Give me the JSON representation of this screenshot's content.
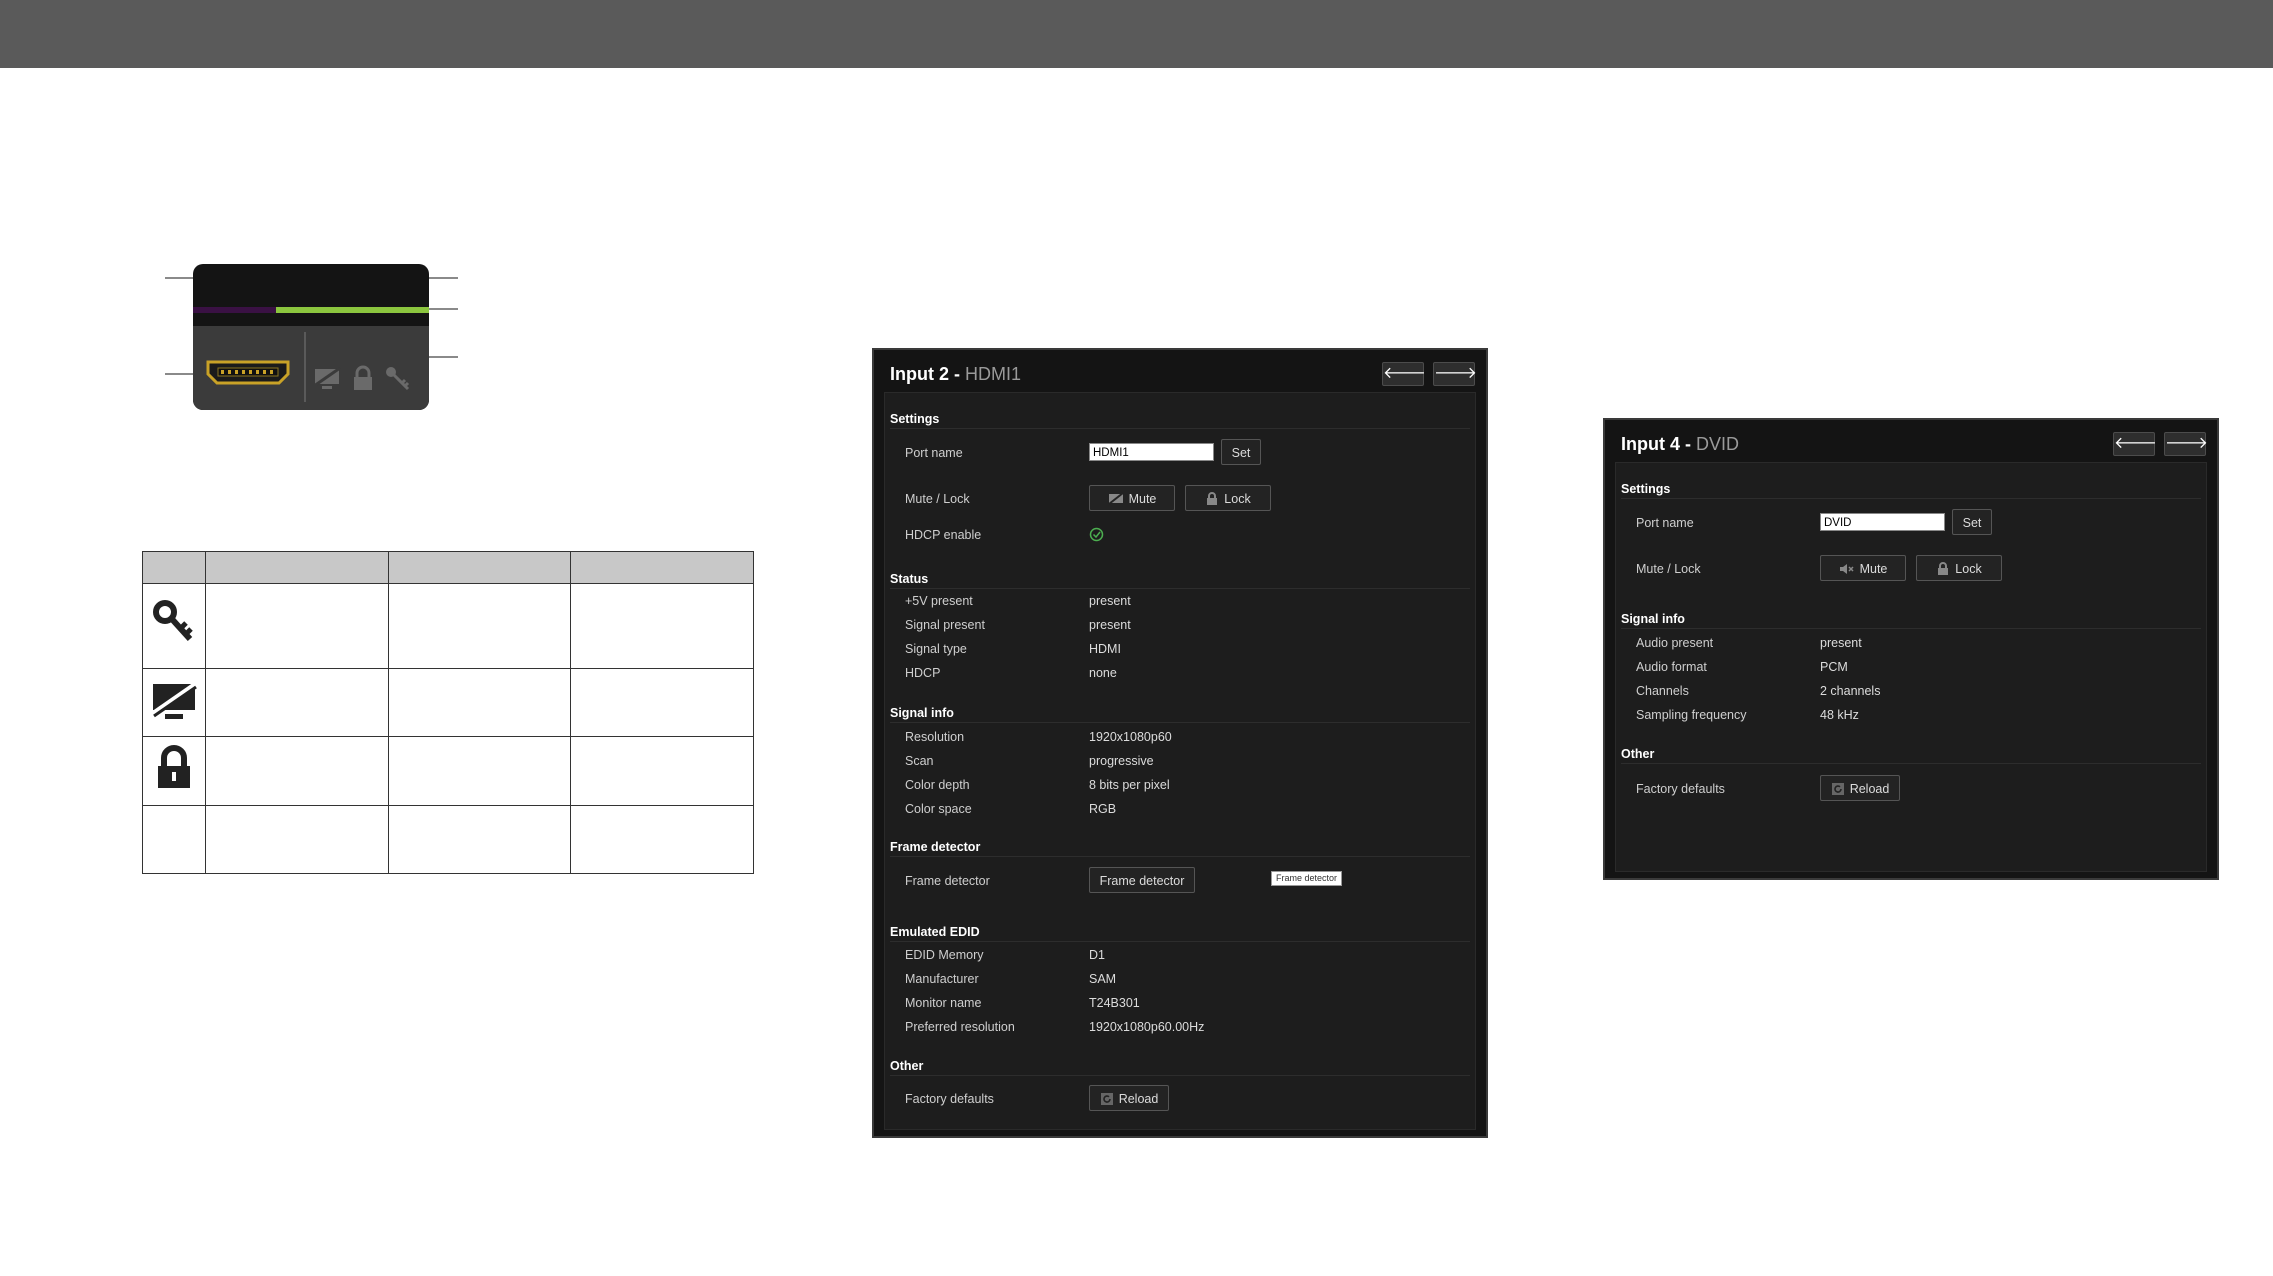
{
  "colors": {
    "topbar": "#5a5a5a",
    "tile_purple": "#3a1144",
    "tile_green": "#8cc63f",
    "hdmi_gold": "#c9a227",
    "check_green": "#4caf50"
  },
  "icon_table": {
    "rows": [
      {
        "icon": "key-icon"
      },
      {
        "icon": "mute-screen-icon"
      },
      {
        "icon": "padlock-icon"
      },
      {
        "icon": ""
      }
    ]
  },
  "panel_left": {
    "title": "Input 2 - ",
    "subtitle": "HDMI1",
    "prev_icon": "arrow-left-icon",
    "next_icon": "arrow-right-icon",
    "sections": {
      "settings": "Settings",
      "status": "Status",
      "signal_info": "Signal info",
      "frame_detector": "Frame detector",
      "emulated_edid": "Emulated EDID",
      "other": "Other"
    },
    "port_name_label": "Port name",
    "port_name_value": "HDMI1",
    "set_label": "Set",
    "mute_lock_label": "Mute / Lock",
    "mute_label": "Mute",
    "lock_label": "Lock",
    "hdcp_enable_label": "HDCP enable",
    "status": [
      {
        "label": "+5V present",
        "value": "present"
      },
      {
        "label": "Signal present",
        "value": "present"
      },
      {
        "label": "Signal type",
        "value": "HDMI"
      },
      {
        "label": "HDCP",
        "value": "none"
      }
    ],
    "signal_info": [
      {
        "label": "Resolution",
        "value": "1920x1080p60"
      },
      {
        "label": "Scan",
        "value": "progressive"
      },
      {
        "label": "Color depth",
        "value": "8 bits per pixel"
      },
      {
        "label": "Color space",
        "value": "RGB"
      }
    ],
    "frame_detector_label": "Frame detector",
    "frame_detector_button": "Frame detector",
    "frame_detector_tooltip": "Frame detector",
    "edid": [
      {
        "label": "EDID Memory",
        "value": "D1"
      },
      {
        "label": "Manufacturer",
        "value": "SAM"
      },
      {
        "label": "Monitor name",
        "value": "T24B301"
      },
      {
        "label": "Preferred resolution",
        "value": "1920x1080p60.00Hz"
      }
    ],
    "factory_defaults_label": "Factory defaults",
    "reload_label": "Reload"
  },
  "panel_right": {
    "title": "Input 4 - ",
    "subtitle": "DVID",
    "prev_icon": "arrow-left-icon",
    "next_icon": "arrow-right-icon",
    "sections": {
      "settings": "Settings",
      "signal_info": "Signal info",
      "other": "Other"
    },
    "port_name_label": "Port name",
    "port_name_value": "DVID",
    "set_label": "Set",
    "mute_lock_label": "Mute / Lock",
    "mute_label": "Mute",
    "lock_label": "Lock",
    "signal_info": [
      {
        "label": "Audio present",
        "value": "present"
      },
      {
        "label": "Audio format",
        "value": "PCM"
      },
      {
        "label": "Channels",
        "value": "2 channels"
      },
      {
        "label": "Sampling frequency",
        "value": "48 kHz"
      }
    ],
    "factory_defaults_label": "Factory defaults",
    "reload_label": "Reload"
  }
}
